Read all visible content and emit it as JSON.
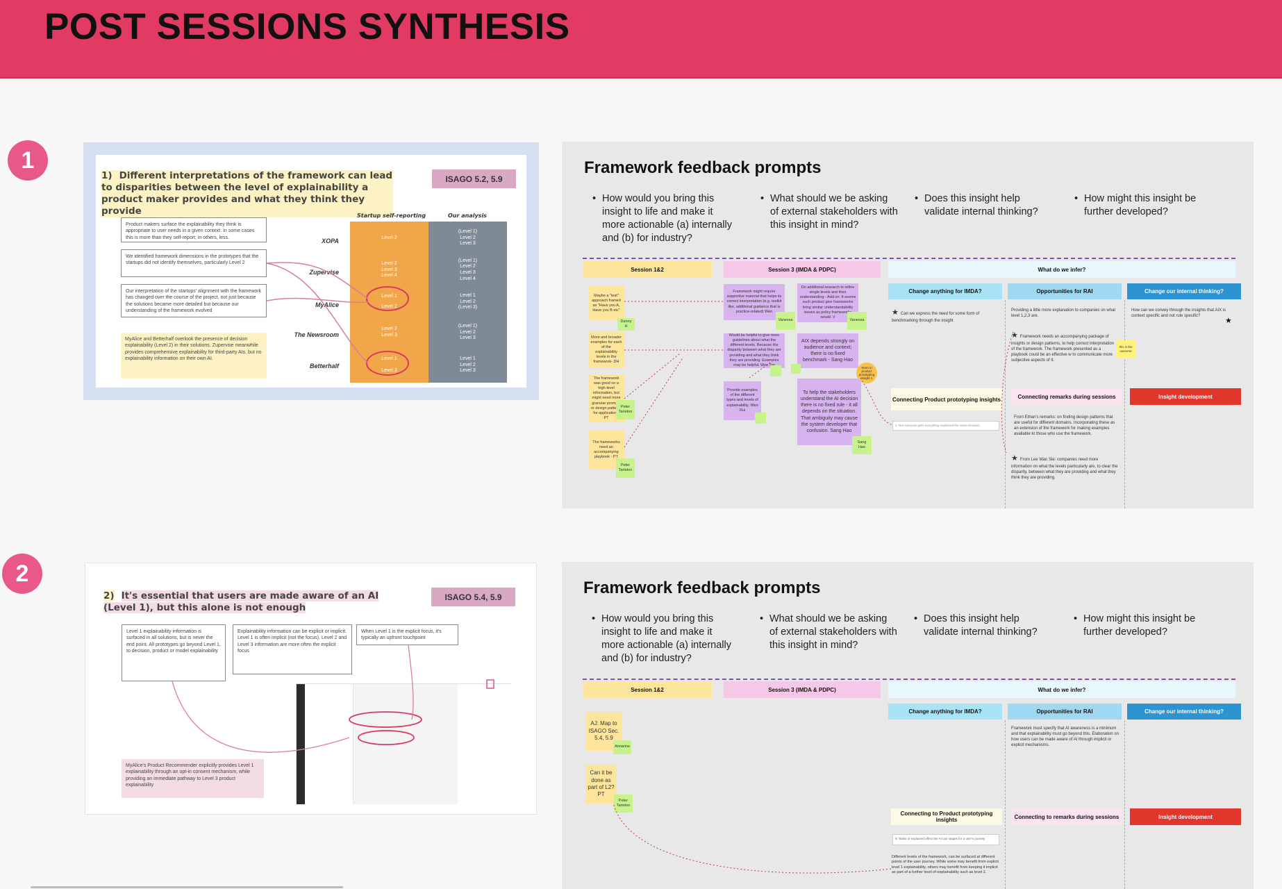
{
  "header": {
    "title": "POST SESSIONS SYNTHESIS",
    "bg": "#e23b63"
  },
  "sections": [
    {
      "number": "1",
      "slide": {
        "heading_num": "1)",
        "heading": "Different interpretations of the framework can lead to disparities between the level of explainability a product maker provides and what they think they provide",
        "isago": "ISAGO 5.2, 5.9",
        "col_startup": "Startup self-reporting",
        "col_ours": "Our analysis",
        "notes": [
          "Product makers surface the explainability they think is appropriate to user needs in a given context. In some cases this is more than they self-report; in others, less.",
          "We identified framework dimensions in the prototypes that the startups did not identify themselves, particularly Level 2",
          "Our interpretation of the startups' alignment with the framework has changed over the course of the project, not just because the solutions became more detailed but because our understanding of the framework evolved"
        ],
        "callout": "MyAlice and Betterhalf overlook the presence of decision explainability (Level 2) in their solutions. Zupervise meanwhile provides comprehensive explainability for third-party AIs, but no explainability information on their own AI.",
        "companies": [
          "XOPA",
          "Zupervise",
          "MyAlice",
          "The Newsroom",
          "Betterhalf"
        ],
        "startup_levels": [
          [
            "Level 2"
          ],
          [
            "Level 2",
            "Level 3",
            "Level 4"
          ],
          [
            "Level 1",
            "Level 2"
          ],
          [
            "Level 2",
            "Level 3"
          ],
          [
            "Level 1",
            "Level 3"
          ]
        ],
        "our_levels": [
          [
            "(Level 1)",
            "Level 2",
            "Level 3"
          ],
          [
            "(Level 1)",
            "Level 2",
            "Level 3",
            "Level 4"
          ],
          [
            "Level 1",
            "Level 2",
            "(Level 3)"
          ],
          [
            "(Level 1)",
            "Level 2",
            "Level 3"
          ],
          [
            "Level 1",
            "Level 2",
            "Level 3"
          ]
        ]
      },
      "feedback": {
        "title": "Framework feedback prompts",
        "prompts": [
          "How would you bring this insight to life and make it more actionable (a) internally and (b) for industry?",
          "What should we be asking of external stakeholders with this insight in mind?",
          "Does this insight help validate internal thinking?",
          "How might this insight be further developed?"
        ],
        "col_headers": [
          "Session 1&2",
          "Session 3 (IMDA & PDPC)",
          "What do we infer?"
        ],
        "sub_headers": [
          "Change anything for IMDA?",
          "Opportunities for RAI",
          "Change our internal thinking?"
        ],
        "lower_headers": [
          "Connecting Product prototyping insights",
          "Connecting remarks during sessions",
          "Insight development"
        ],
        "session12_notes": [
          "Maybe a \"test\" approach framed as \"Have you A, Have you B etc\"",
          "More and broader examples for each of the explainability levels in the framework- DH",
          "The framework was good on a high-level information, but might need more granular prompts or design patterns for application - PT",
          "The frameworks need an accompanying playbook - PT"
        ],
        "session12_authors": [
          "Danny H",
          "Peter Tarleton",
          "Peter Tarleton"
        ],
        "session3_notes": [
          "Framework might require supportive material that helps its correct interpretation (e.g. toolkit like, additional guidance that is practice-related) Wen",
          "Do additional research to refine single levels and their understanding - Add on: It seems such product give frameworks bring similar understandability issues as policy frameworks would. V",
          "Would be helpful to give more guidelines about what the different levels. Because the disparity between what they are providing and what they think they are providing. Examples may be helpful. Wen Sie",
          "AIX depends strongly on audience and context; there is no fixed benchmark - Sang Hao",
          "Provide examples of the different types and levels of explainability. Wen Rui",
          "To help the stakeholders understand the AI decision there is no fixed rule - it all depends on the situation. That ambiguity may cause the system developer that confusion. Sang Hao"
        ],
        "session3_authors": [
          "Vanessa",
          "Vanessa",
          "Sang Hao"
        ],
        "circle_note": "Seen in product prototyping insight 1",
        "imda_note": "Can we express the need for some form of benchmarking through the insight",
        "rai_notes": [
          "Providing a little more explanation to companies on what level 1,2,3 are.",
          "Framework needs an accompanying package of insights or design patterns, to help correct interpretation of the framework. The framework presented as a playbook could be an effective w to communicate more subjective aspects of it.",
          "From Ethan's remarks: on finding design patterns that are useful for different domains. Incorporating these as an extension of the framework for making examples available to those who use the framework.",
          "From Lee Wan Sie: companies need more information on what the levels particularly are, to clear the disparity, between what they are providing and what they think they are providing."
        ],
        "small_sticky": "this is the outcome",
        "internal_note": "How can we convey through the insights that AIX is context specific and not rule specific?",
        "link_note": "1. Not everyone gets everything explained the same situation"
      }
    },
    {
      "number": "2",
      "slide": {
        "heading_num": "2)",
        "heading": "It's essential that users are made aware of an AI (Level 1), but this alone is not enough",
        "isago": "ISAGO 5.4, 5.9",
        "notes": [
          "Level 1 explainability information is surfaced in all solutions, but is never the end point. All prototypes go beyond Level 1, to decision, product or model explainability",
          "Explainability information can be explicit or implicit. Level 1 is often implicit (not the focus). Level 2 and Level 3 information are more often the explicit focus",
          "When Level 1 is the explicit focus, it's typically an upfront touchpoint"
        ],
        "callout": "MyAlice's Product Recommender explicitly provides Level 1 explainability through an opt-in consent mechanism, while providing an immediate pathway to Level 3 product explainability"
      },
      "feedback": {
        "title": "Framework feedback prompts",
        "prompts": [
          "How would you bring this insight to life and make it more actionable (a) internally and (b) for industry?",
          "What should we be asking of external stakeholders with this insight in mind?",
          "Does this insight help validate internal thinking?",
          "How might this insight be further developed?"
        ],
        "col_headers": [
          "Session 1&2",
          "Session 3 (IMDA & PDPC)",
          "What do we infer?"
        ],
        "sub_headers": [
          "Change anything for IMDA?",
          "Opportunities for RAI",
          "Change our internal thinking?"
        ],
        "lower_headers": [
          "Connecting to Product prototyping insights",
          "Connecting to remarks during sessions",
          "Insight development"
        ],
        "session12_notes": [
          "AJ: Map to ISAGO Sec. 5.4, 5.9",
          "Can it be done as part of L2? PT"
        ],
        "session12_authors": [
          "Annarine",
          "Peter Tarleton"
        ],
        "rai_note": "Framework must specify that AI awareness is a minimum and that explainability must go beyond this. Elaboration on how users can be made aware of AI through implicit or explicit mechanisms.",
        "link_note": "6. Tasks of explained effect the AI can stages for a user's journey",
        "lower_note": "Different levels of the framework, can be surfaced at different points of the user journey. While some may benefit from explicit level 1 explainability, others may benefit from keeping it implicit as part of a further level of explainability such as level 2."
      }
    }
  ],
  "colors": {
    "session12": "#fde69c",
    "session3": "#f6c7e6",
    "infer": "#e7f7fb",
    "imda": "#a8e4f5",
    "rai": "#9fd8f0",
    "internal": "#2e93d1",
    "insight_dev": "#e0362c",
    "connect_remarks": "#fbe4f0",
    "dash": "#7b4fb4"
  }
}
